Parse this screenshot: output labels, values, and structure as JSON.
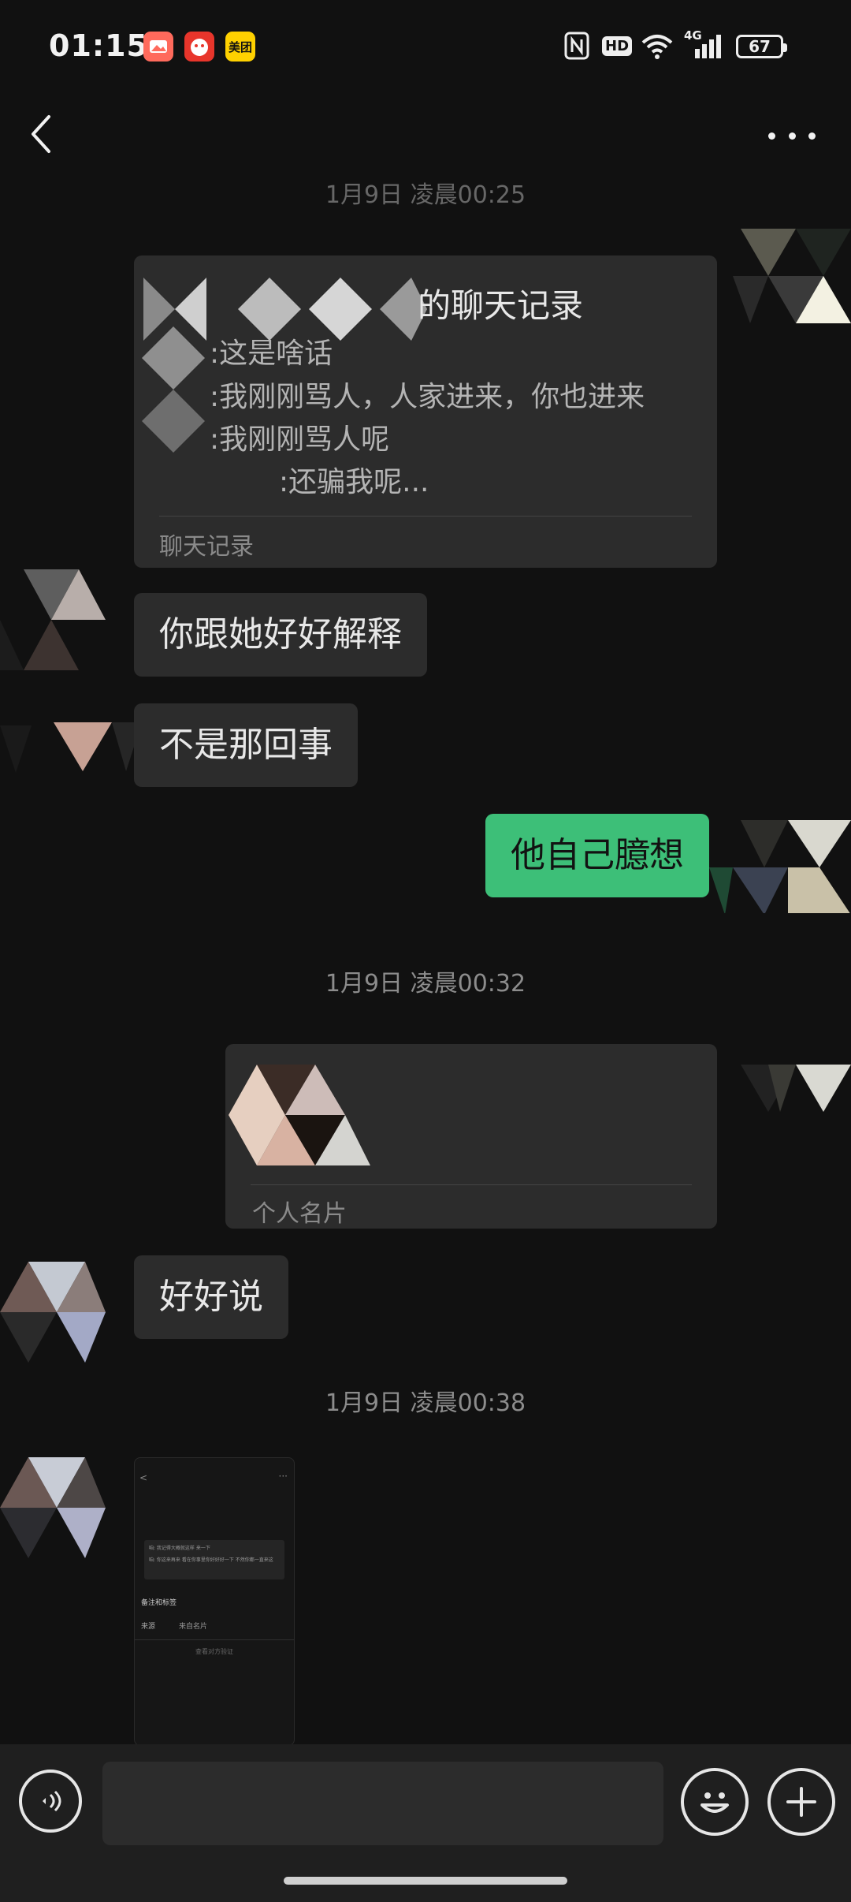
{
  "status_bar": {
    "time": "01:15",
    "app_badge_meituan": "美团",
    "hd_label": "HD",
    "network_label": "4G",
    "battery": "67"
  },
  "header": {
    "title": ""
  },
  "messages": {
    "ts1": "1月9日 凌晨00:25",
    "forward_card": {
      "title": "的聊天记录",
      "lines": [
        ":这是啥话",
        ":我刚刚骂人，人家进来，你也进来",
        ":我刚刚骂人呢",
        ":还骗我呢..."
      ],
      "footer": "聊天记录"
    },
    "msg1": "你跟她好好解释",
    "msg2": "不是那回事",
    "msg3": "他自己臆想",
    "ts2": "1月9日 凌晨00:32",
    "contact_card_footer": "个人名片",
    "msg4": "好好说",
    "ts3": "1月9日 凌晨00:38"
  },
  "screenshot_thumb": {
    "line1": "咱: 我记得大概就这样 来一下",
    "line2": "咱: 你这来再来 看在你事里你好好好一下 不然你都一直来这",
    "row1": "备注和标签",
    "row2_label": "来源",
    "row2_value": "来自名片",
    "row3": "查看对方验证"
  },
  "colors": {
    "background": "#111111",
    "bubble": "#2c2c2c",
    "green": "#3dbf78"
  }
}
